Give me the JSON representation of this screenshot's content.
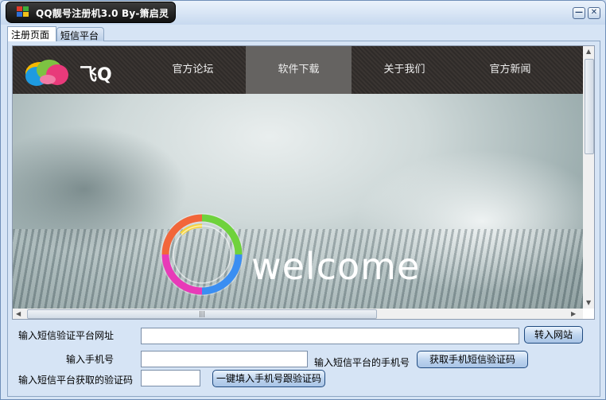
{
  "window": {
    "title": "QQ靓号注册机3.0 By-箫启灵",
    "minimize_label": "—",
    "close_label": "✕"
  },
  "tabs": [
    {
      "label": "注册页面"
    },
    {
      "label": "短信平台"
    }
  ],
  "website": {
    "logo_text": "飞Q",
    "nav": [
      {
        "label": "官方论坛"
      },
      {
        "label": "软件下载"
      },
      {
        "label": "关于我们"
      },
      {
        "label": "官方新闻"
      }
    ],
    "hero_text": "welcome",
    "scroll_grip": "|||"
  },
  "form": {
    "url_label": "输入短信验证平台网址",
    "url_value": "",
    "goto_button": "转入网站",
    "phone_label": "输入手机号",
    "phone_value": "",
    "platform_phone_label": "输入短信平台的手机号",
    "get_code_button": "获取手机短信验证码",
    "code_label": "输入短信平台获取的验证码",
    "code_value": "",
    "fill_button": "一键填入手机号跟验证码"
  }
}
